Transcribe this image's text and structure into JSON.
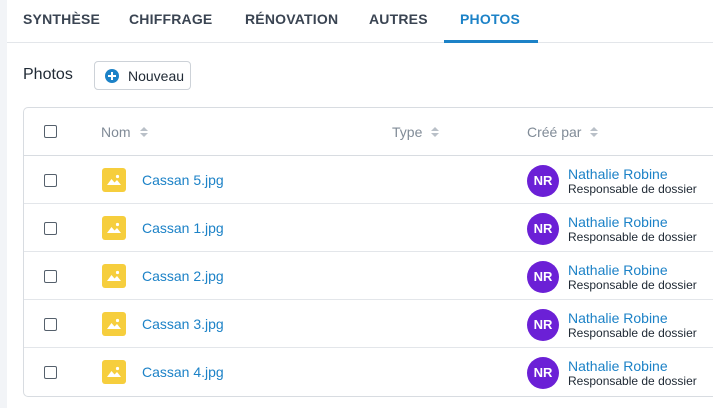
{
  "tabs": [
    {
      "label": "SYNTHÈSE",
      "active": false
    },
    {
      "label": "CHIFFRAGE",
      "active": false
    },
    {
      "label": "RÉNOVATION",
      "active": false
    },
    {
      "label": "AUTRES",
      "active": false
    },
    {
      "label": "PHOTOS",
      "active": true
    }
  ],
  "section": {
    "title": "Photos",
    "new_button_label": "Nouveau"
  },
  "table": {
    "columns": [
      "Nom",
      "Type",
      "Créé par"
    ],
    "rows": [
      {
        "file": "Cassan 5.jpg",
        "type": "",
        "initials": "NR",
        "author": "Nathalie Robine",
        "role": "Responsable de dossier"
      },
      {
        "file": "Cassan 1.jpg",
        "type": "",
        "initials": "NR",
        "author": "Nathalie Robine",
        "role": "Responsable de dossier"
      },
      {
        "file": "Cassan 2.jpg",
        "type": "",
        "initials": "NR",
        "author": "Nathalie Robine",
        "role": "Responsable de dossier"
      },
      {
        "file": "Cassan 3.jpg",
        "type": "",
        "initials": "NR",
        "author": "Nathalie Robine",
        "role": "Responsable de dossier"
      },
      {
        "file": "Cassan 4.jpg",
        "type": "",
        "initials": "NR",
        "author": "Nathalie Robine",
        "role": "Responsable de dossier"
      }
    ]
  },
  "colors": {
    "accent": "#1c82c7",
    "avatar": "#6b20d6",
    "image_icon": "#f6ce3d"
  },
  "icons": {
    "new_button": "plus-circle-icon",
    "file": "image-file-icon",
    "sort": "sort-icon"
  }
}
